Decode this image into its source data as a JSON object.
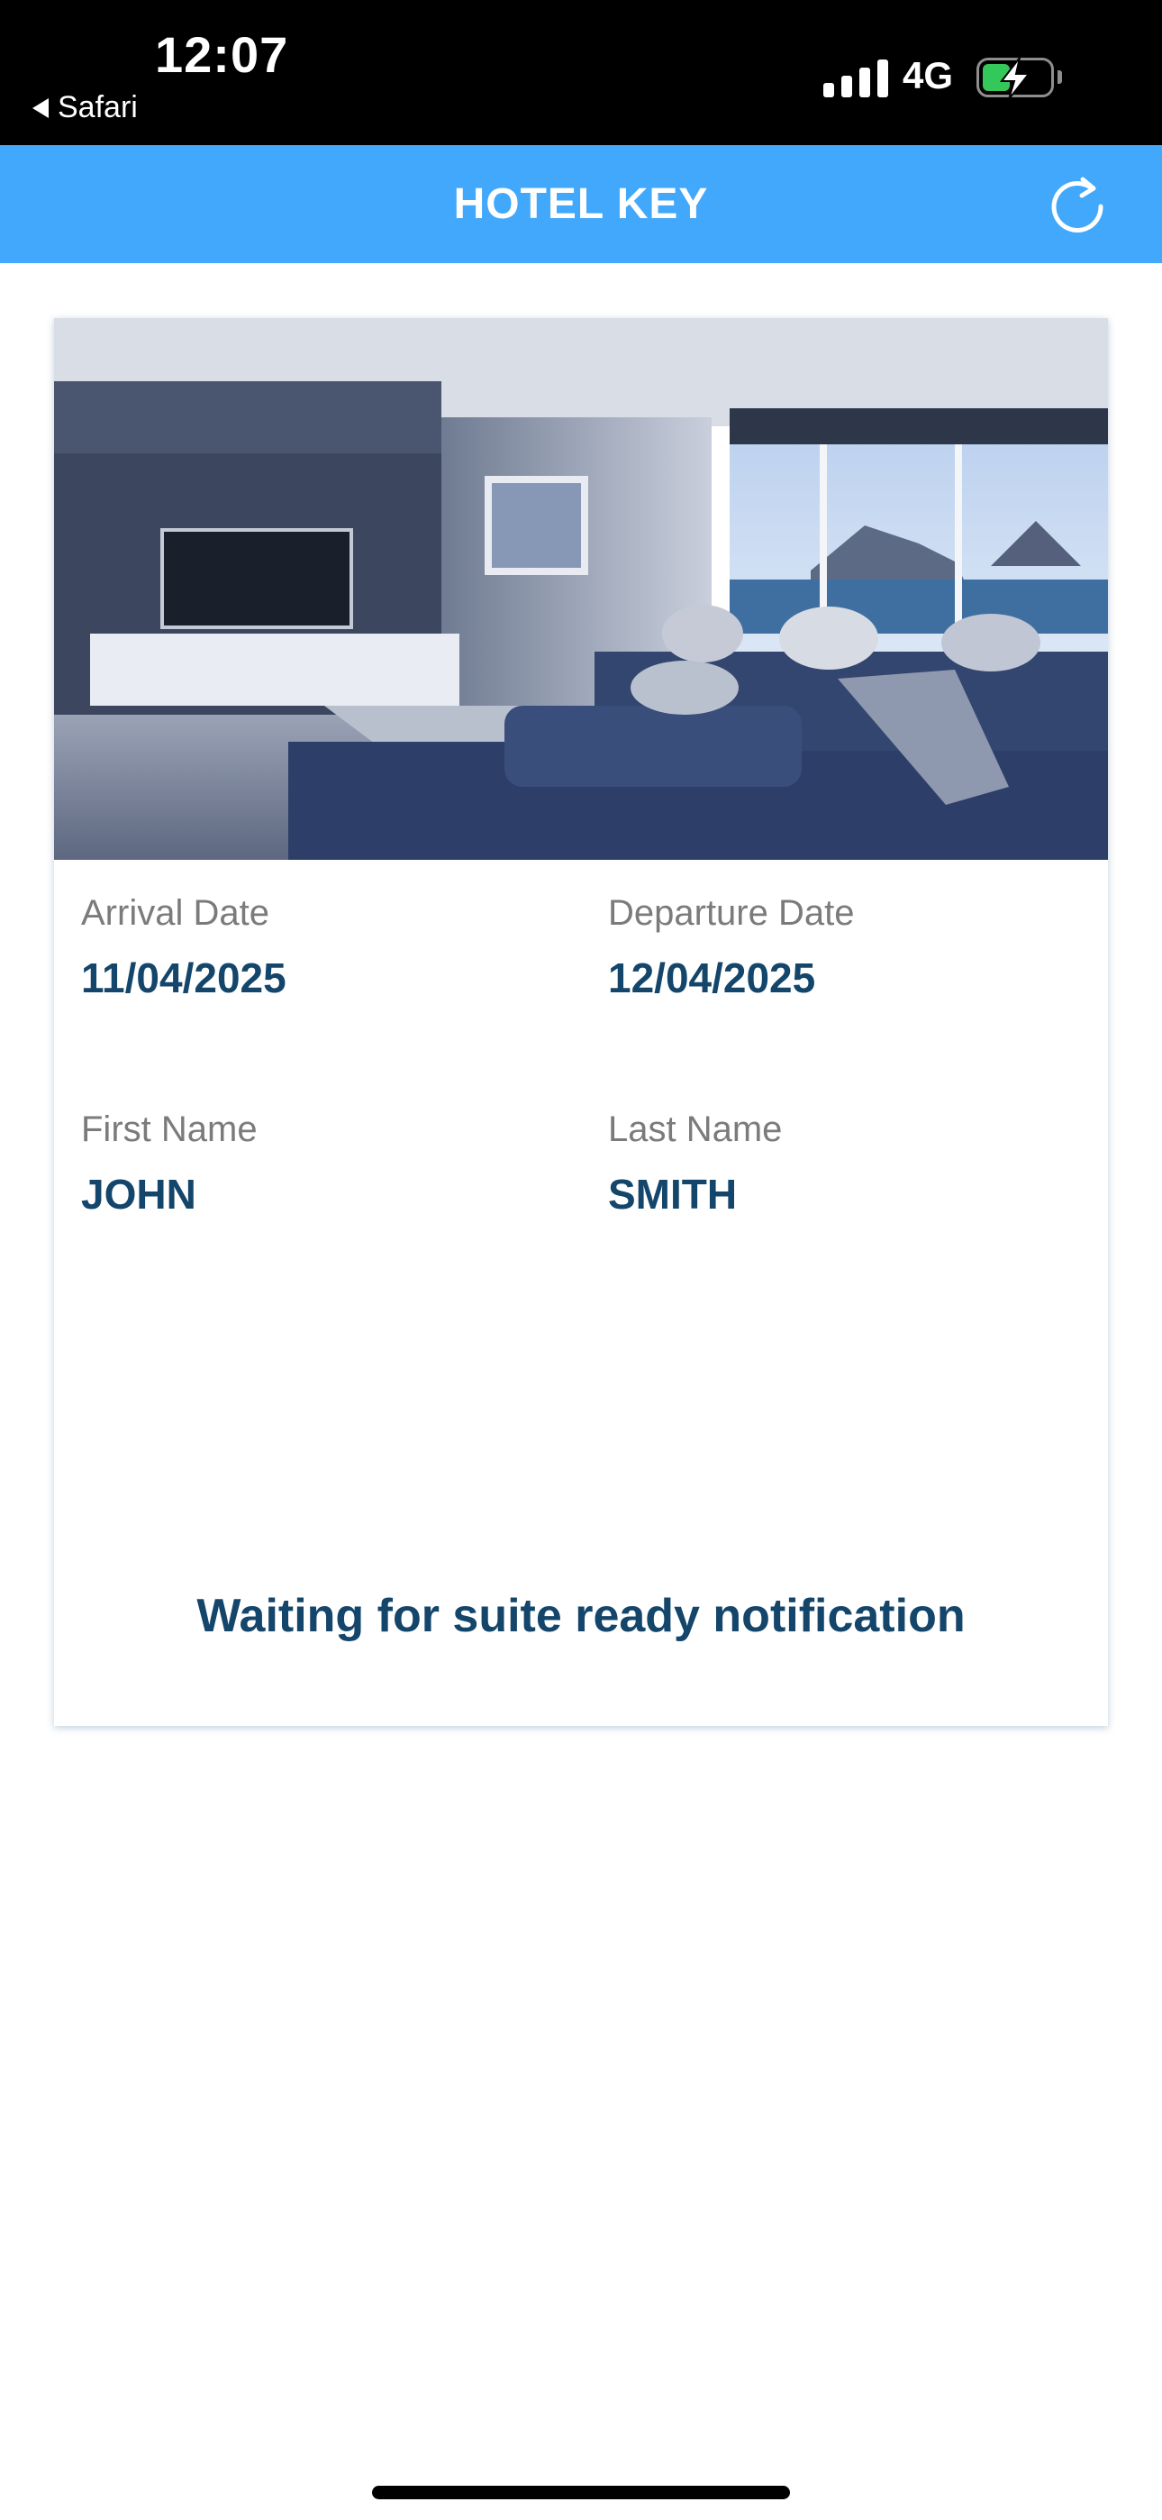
{
  "status_bar": {
    "time": "12:07",
    "back_app": "Safari",
    "network": "4G"
  },
  "header": {
    "title": "HOTEL KEY",
    "refresh_icon": "refresh-icon"
  },
  "card": {
    "image_description_icon": "room-photo",
    "arrival_label": "Arrival Date",
    "arrival_value": "11/04/2025",
    "departure_label": "Departure Date",
    "departure_value": "12/04/2025",
    "first_name_label": "First Name",
    "first_name_value": "JOHN",
    "last_name_label": "Last Name",
    "last_name_value": "SMITH",
    "status_message": "Waiting for suite ready notification"
  },
  "colors": {
    "header_bg": "#42a8fb",
    "value_text": "#14456a",
    "label_text": "#7b7b7b"
  }
}
